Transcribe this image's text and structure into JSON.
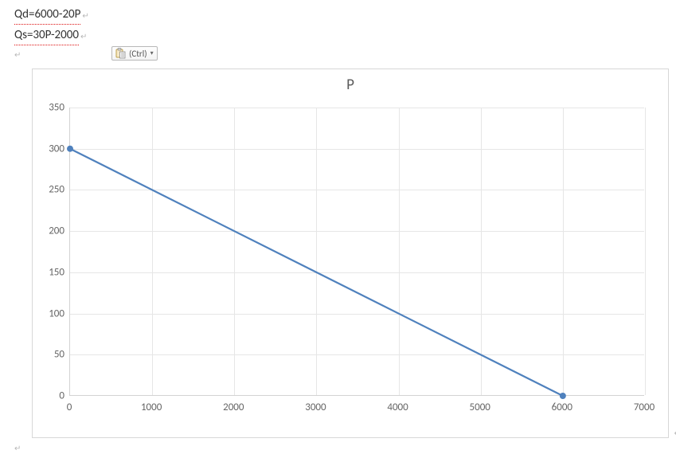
{
  "equations": {
    "qd": "Qd=6000-20P",
    "qs": "Qs=30P-2000"
  },
  "paste_options_label": "(Ctrl)",
  "chart_data": {
    "type": "line",
    "title": "P",
    "xlabel": "",
    "ylabel": "",
    "xlim": [
      0,
      7000
    ],
    "ylim": [
      0,
      350
    ],
    "yticks": [
      0,
      50,
      100,
      150,
      200,
      250,
      300,
      350
    ],
    "xticks": [
      0,
      1000,
      2000,
      3000,
      4000,
      5000,
      6000,
      7000
    ],
    "series": [
      {
        "name": "P",
        "color": "#4f81bd",
        "x": [
          0,
          6000
        ],
        "y": [
          300,
          0
        ],
        "markers": true
      }
    ]
  }
}
